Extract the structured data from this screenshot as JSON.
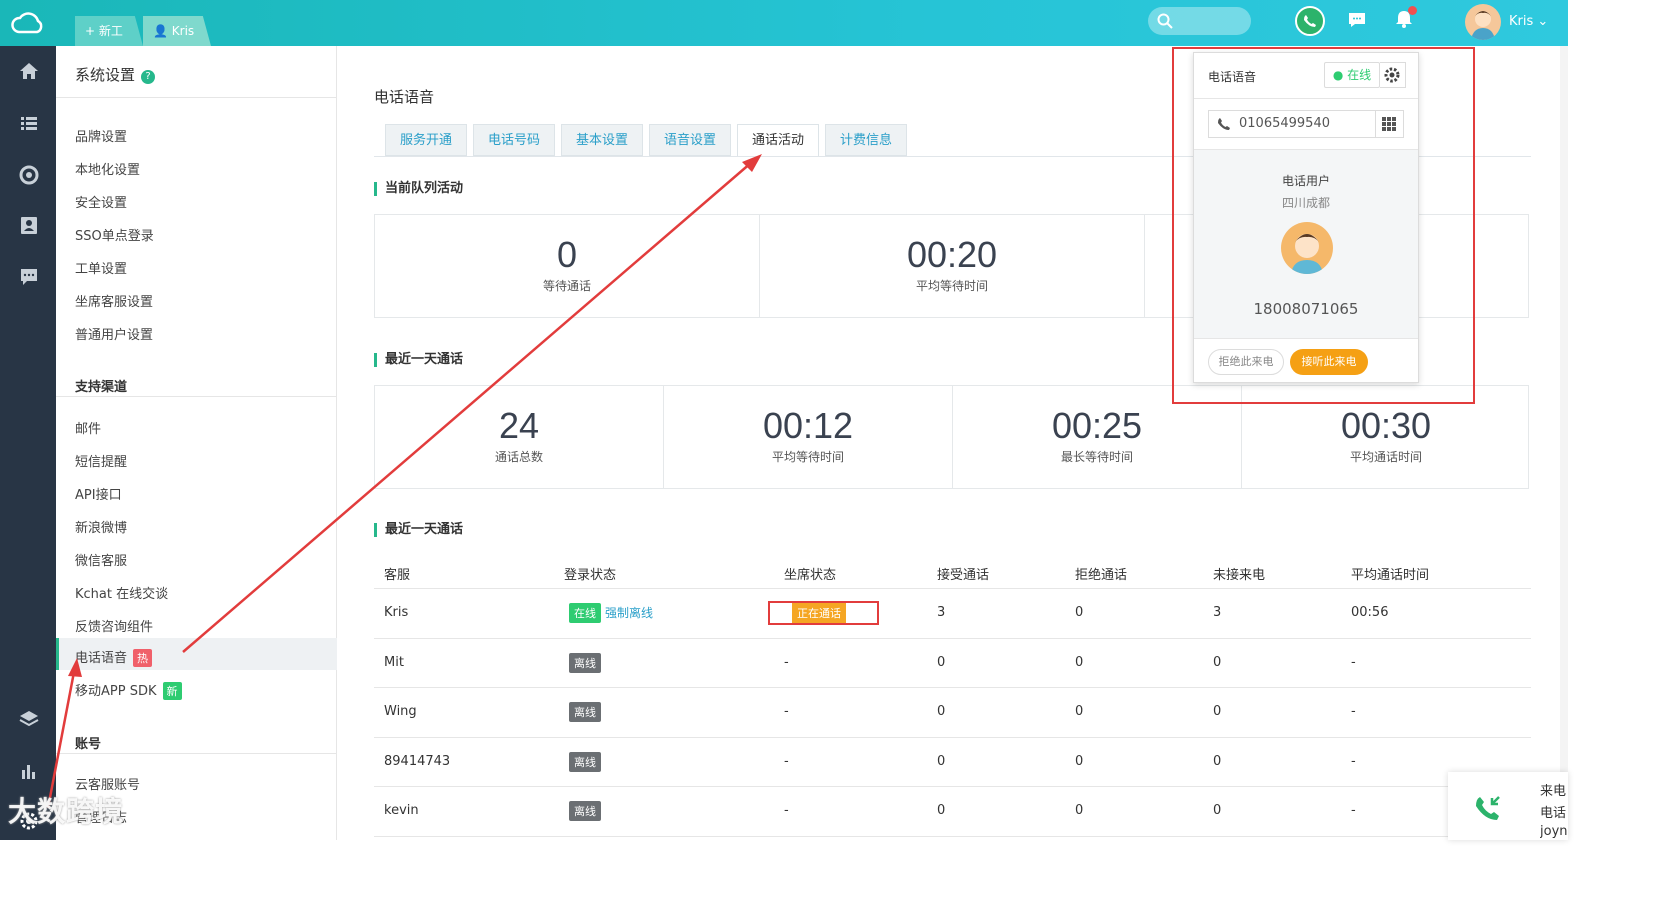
{
  "topbar": {
    "new_ticket": "+ 新工单",
    "user_tab": "Kris",
    "user_name": "Kris ⌄"
  },
  "sidebar": {
    "title": "系统设置",
    "help": "?",
    "group1": [
      "品牌设置",
      "本地化设置",
      "安全设置",
      "SSO单点登录",
      "工单设置",
      "坐席客服设置",
      "普通用户设置"
    ],
    "section_channels": "支持渠道",
    "group2": [
      "邮件",
      "短信提醒",
      "API接口",
      "新浪微博",
      "微信客服",
      "Kchat 在线交谈",
      "反馈咨询组件",
      "电话语音",
      "移动APP SDK"
    ],
    "hot_badge": "热",
    "new_badge": "新",
    "section_account": "账号",
    "group3": [
      "云客服账号",
      "管理日志"
    ]
  },
  "main": {
    "title": "电话语音",
    "tabs": [
      "服务开通",
      "电话号码",
      "基本设置",
      "语音设置",
      "通话活动",
      "计费信息"
    ],
    "queue_title": "当前队列活动",
    "queue_stats": [
      {
        "num": "0",
        "label": "等待通话"
      },
      {
        "num": "00:20",
        "label": "平均等待时间"
      }
    ],
    "day_title": "最近一天通话",
    "day_stats": [
      {
        "num": "24",
        "label": "通话总数"
      },
      {
        "num": "00:12",
        "label": "平均等待时间"
      },
      {
        "num": "00:25",
        "label": "最长等待时间"
      },
      {
        "num": "00:30",
        "label": "平均通话时间"
      }
    ],
    "table_title": "最近一天通话",
    "columns": [
      "客服",
      "登录状态",
      "坐席状态",
      "接受通话",
      "拒绝通话",
      "未接来电",
      "平均通话时间"
    ],
    "rows": [
      {
        "agent": "Kris",
        "login": "在线",
        "force": "强制离线",
        "seat": "正在通话",
        "accept": "3",
        "reject": "0",
        "missed": "3",
        "avg": "00:56"
      },
      {
        "agent": "Mit",
        "login": "离线",
        "seat": "-",
        "accept": "0",
        "reject": "0",
        "missed": "0",
        "avg": "-"
      },
      {
        "agent": "Wing",
        "login": "离线",
        "seat": "-",
        "accept": "0",
        "reject": "0",
        "missed": "0",
        "avg": "-"
      },
      {
        "agent": "89414743",
        "login": "离线",
        "seat": "-",
        "accept": "0",
        "reject": "0",
        "missed": "0",
        "avg": "-"
      },
      {
        "agent": "kevin",
        "login": "离线",
        "seat": "-",
        "accept": "0",
        "reject": "0",
        "missed": "0",
        "avg": "-"
      }
    ]
  },
  "popup": {
    "title": "电话语音",
    "status": "● 在线",
    "number": "01065499540",
    "caller": "电话用户",
    "location": "四川成都",
    "caller_number": "18008071065",
    "reject": "拒绝此来电",
    "accept": "接听此来电"
  },
  "incoming": {
    "line1": "来电",
    "line2": "电话",
    "line3": "joyn"
  },
  "watermark": "大数跨境",
  "colors": {
    "accent": "#26b88c",
    "topbar": "#1ab7b8",
    "nav": "#283545",
    "highlight": "#e23c3c",
    "warning": "#f5a623"
  }
}
